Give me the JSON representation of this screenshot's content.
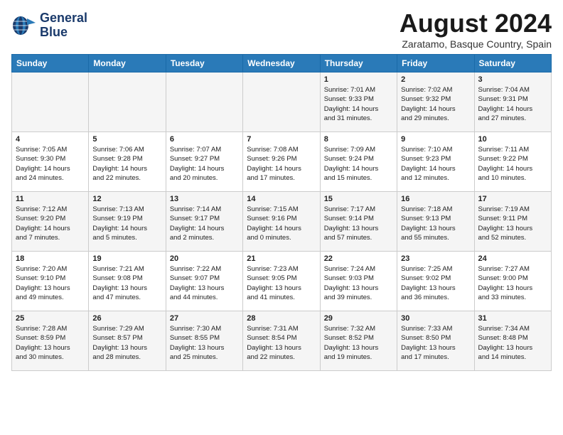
{
  "logo": {
    "line1": "General",
    "line2": "Blue"
  },
  "title": "August 2024",
  "subtitle": "Zaratamo, Basque Country, Spain",
  "weekdays": [
    "Sunday",
    "Monday",
    "Tuesday",
    "Wednesday",
    "Thursday",
    "Friday",
    "Saturday"
  ],
  "weeks": [
    [
      {
        "num": "",
        "info": ""
      },
      {
        "num": "",
        "info": ""
      },
      {
        "num": "",
        "info": ""
      },
      {
        "num": "",
        "info": ""
      },
      {
        "num": "1",
        "info": "Sunrise: 7:01 AM\nSunset: 9:33 PM\nDaylight: 14 hours\nand 31 minutes."
      },
      {
        "num": "2",
        "info": "Sunrise: 7:02 AM\nSunset: 9:32 PM\nDaylight: 14 hours\nand 29 minutes."
      },
      {
        "num": "3",
        "info": "Sunrise: 7:04 AM\nSunset: 9:31 PM\nDaylight: 14 hours\nand 27 minutes."
      }
    ],
    [
      {
        "num": "4",
        "info": "Sunrise: 7:05 AM\nSunset: 9:30 PM\nDaylight: 14 hours\nand 24 minutes."
      },
      {
        "num": "5",
        "info": "Sunrise: 7:06 AM\nSunset: 9:28 PM\nDaylight: 14 hours\nand 22 minutes."
      },
      {
        "num": "6",
        "info": "Sunrise: 7:07 AM\nSunset: 9:27 PM\nDaylight: 14 hours\nand 20 minutes."
      },
      {
        "num": "7",
        "info": "Sunrise: 7:08 AM\nSunset: 9:26 PM\nDaylight: 14 hours\nand 17 minutes."
      },
      {
        "num": "8",
        "info": "Sunrise: 7:09 AM\nSunset: 9:24 PM\nDaylight: 14 hours\nand 15 minutes."
      },
      {
        "num": "9",
        "info": "Sunrise: 7:10 AM\nSunset: 9:23 PM\nDaylight: 14 hours\nand 12 minutes."
      },
      {
        "num": "10",
        "info": "Sunrise: 7:11 AM\nSunset: 9:22 PM\nDaylight: 14 hours\nand 10 minutes."
      }
    ],
    [
      {
        "num": "11",
        "info": "Sunrise: 7:12 AM\nSunset: 9:20 PM\nDaylight: 14 hours\nand 7 minutes."
      },
      {
        "num": "12",
        "info": "Sunrise: 7:13 AM\nSunset: 9:19 PM\nDaylight: 14 hours\nand 5 minutes."
      },
      {
        "num": "13",
        "info": "Sunrise: 7:14 AM\nSunset: 9:17 PM\nDaylight: 14 hours\nand 2 minutes."
      },
      {
        "num": "14",
        "info": "Sunrise: 7:15 AM\nSunset: 9:16 PM\nDaylight: 14 hours\nand 0 minutes."
      },
      {
        "num": "15",
        "info": "Sunrise: 7:17 AM\nSunset: 9:14 PM\nDaylight: 13 hours\nand 57 minutes."
      },
      {
        "num": "16",
        "info": "Sunrise: 7:18 AM\nSunset: 9:13 PM\nDaylight: 13 hours\nand 55 minutes."
      },
      {
        "num": "17",
        "info": "Sunrise: 7:19 AM\nSunset: 9:11 PM\nDaylight: 13 hours\nand 52 minutes."
      }
    ],
    [
      {
        "num": "18",
        "info": "Sunrise: 7:20 AM\nSunset: 9:10 PM\nDaylight: 13 hours\nand 49 minutes."
      },
      {
        "num": "19",
        "info": "Sunrise: 7:21 AM\nSunset: 9:08 PM\nDaylight: 13 hours\nand 47 minutes."
      },
      {
        "num": "20",
        "info": "Sunrise: 7:22 AM\nSunset: 9:07 PM\nDaylight: 13 hours\nand 44 minutes."
      },
      {
        "num": "21",
        "info": "Sunrise: 7:23 AM\nSunset: 9:05 PM\nDaylight: 13 hours\nand 41 minutes."
      },
      {
        "num": "22",
        "info": "Sunrise: 7:24 AM\nSunset: 9:03 PM\nDaylight: 13 hours\nand 39 minutes."
      },
      {
        "num": "23",
        "info": "Sunrise: 7:25 AM\nSunset: 9:02 PM\nDaylight: 13 hours\nand 36 minutes."
      },
      {
        "num": "24",
        "info": "Sunrise: 7:27 AM\nSunset: 9:00 PM\nDaylight: 13 hours\nand 33 minutes."
      }
    ],
    [
      {
        "num": "25",
        "info": "Sunrise: 7:28 AM\nSunset: 8:59 PM\nDaylight: 13 hours\nand 30 minutes."
      },
      {
        "num": "26",
        "info": "Sunrise: 7:29 AM\nSunset: 8:57 PM\nDaylight: 13 hours\nand 28 minutes."
      },
      {
        "num": "27",
        "info": "Sunrise: 7:30 AM\nSunset: 8:55 PM\nDaylight: 13 hours\nand 25 minutes."
      },
      {
        "num": "28",
        "info": "Sunrise: 7:31 AM\nSunset: 8:54 PM\nDaylight: 13 hours\nand 22 minutes."
      },
      {
        "num": "29",
        "info": "Sunrise: 7:32 AM\nSunset: 8:52 PM\nDaylight: 13 hours\nand 19 minutes."
      },
      {
        "num": "30",
        "info": "Sunrise: 7:33 AM\nSunset: 8:50 PM\nDaylight: 13 hours\nand 17 minutes."
      },
      {
        "num": "31",
        "info": "Sunrise: 7:34 AM\nSunset: 8:48 PM\nDaylight: 13 hours\nand 14 minutes."
      }
    ]
  ]
}
